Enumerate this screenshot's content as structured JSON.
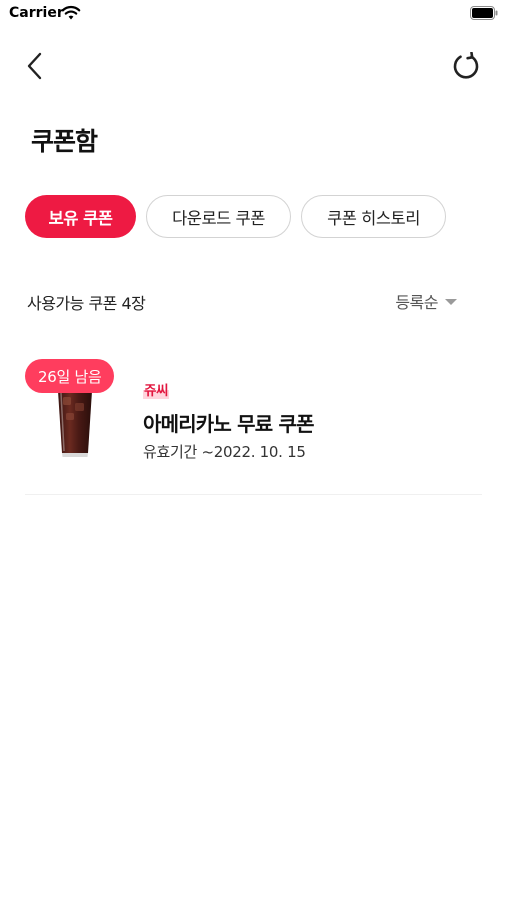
{
  "status_bar": {
    "carrier": "Carrier"
  },
  "header": {
    "title": "쿠폰함"
  },
  "tabs": [
    {
      "label": "보유 쿠폰",
      "active": true
    },
    {
      "label": "다운로드 쿠폰",
      "active": false
    },
    {
      "label": "쿠폰 히스토리",
      "active": false
    }
  ],
  "list": {
    "count_text": "사용가능 쿠폰 4장",
    "sort_label": "등록순"
  },
  "coupons": [
    {
      "days_left": "26일 남음",
      "brand": "쥬씨",
      "title": "아메리카노 무료 쿠폰",
      "expiry": "유효기간 ~2022. 10. 15"
    }
  ],
  "colors": {
    "accent": "#ee1a43",
    "badge": "#ff3d5e",
    "brand_text": "#e2163f"
  },
  "icons": [
    "wifi-icon",
    "battery-icon",
    "back-icon",
    "refresh-icon",
    "sort-arrow-icon"
  ]
}
